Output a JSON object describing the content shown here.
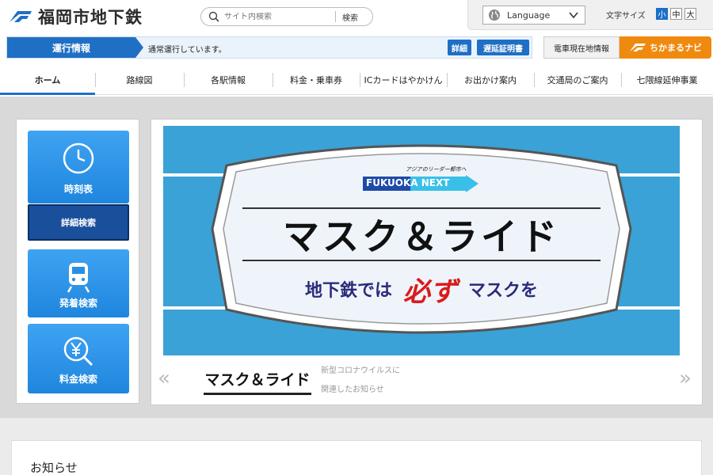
{
  "header": {
    "logo_text": "福岡市地下鉄",
    "search": {
      "placeholder": "サイト内検索",
      "button": "検索"
    },
    "language": "Language",
    "font_size": {
      "label": "文字サイズ",
      "options": [
        "小",
        "中",
        "大"
      ],
      "selected": "小"
    }
  },
  "operation": {
    "title": "運行情報",
    "status": "通常運行しています。",
    "detail_button": "詳細",
    "delay_cert_button": "遅延証明書",
    "train_location": "電車現在地情報",
    "navi": "ちかまるナビ"
  },
  "nav": {
    "items": [
      "ホーム",
      "路線図",
      "各駅情報",
      "料金・乗車券",
      "ICカードはやかけん",
      "お出かけ案内",
      "交通局のご案内",
      "七隈線延伸事業"
    ],
    "active": "ホーム"
  },
  "side": {
    "timetable": "時刻表",
    "detail_search": "詳細検索",
    "departure_search": "発着検索",
    "fare_search": "料金検索"
  },
  "banner": {
    "brand": "FUKUOKA NEXT",
    "brand_tagline": "アジアのリーダー都市へ",
    "headline": "マスク＆ライド",
    "sub_before": "地下鉄では",
    "sub_emph": "必ず",
    "sub_after": "マスクを"
  },
  "slider": {
    "caption_title": "マスク＆ライド",
    "caption_desc_1": "新型コロナウイルスに",
    "caption_desc_2": "関連したお知らせ"
  },
  "notice": {
    "title": "お知らせ"
  },
  "colors": {
    "brand_blue": "#1f6fc5",
    "navi_orange": "#f08a0f",
    "banner_blue": "#3aa2d6"
  }
}
